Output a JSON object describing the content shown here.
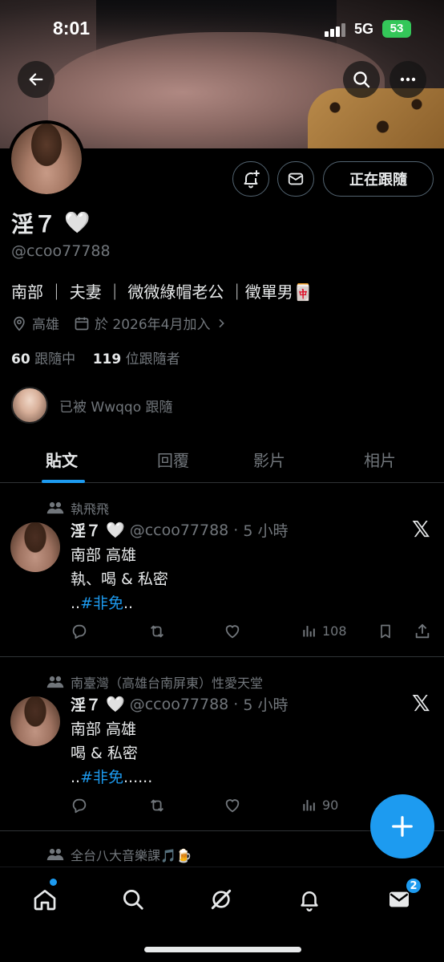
{
  "status_bar": {
    "time": "8:01",
    "network": "5G",
    "battery": "53"
  },
  "profile": {
    "name": "淫７",
    "name_emoji": "🤍",
    "handle": "@ccoo77788",
    "bio": "南部 ｜ 夫妻 ｜ 微微綠帽老公 ｜徵單男🀄",
    "location": "高雄",
    "joined": "於 2026年4月加入",
    "following_count": "60",
    "following_label": "跟隨中",
    "followers_count": "119",
    "followers_label": "位跟隨者",
    "followed_by": "已被 Wwqqo 跟隨",
    "follow_button": "正在跟隨"
  },
  "tabs": [
    "貼文",
    "回覆",
    "影片",
    "相片"
  ],
  "posts": [
    {
      "community": "執飛飛",
      "name": "淫７",
      "handle": "@ccoo77788",
      "time": "5 小時",
      "line1": "南部 高雄",
      "line2": "執、喝 & 私密",
      "prefix": "..",
      "hashtag": "#非免",
      "suffix": "..",
      "views": "108"
    },
    {
      "community": "南臺灣（高雄台南屏東）性愛天堂",
      "name": "淫７",
      "handle": "@ccoo77788",
      "time": "5 小時",
      "line1": "南部 高雄",
      "line2": "喝 & 私密",
      "prefix": "..",
      "hashtag": "#非免",
      "suffix": "......",
      "views": "90"
    },
    {
      "community": "全台八大音樂課🎵🍺"
    }
  ],
  "nav": {
    "messages_badge": "2"
  },
  "colors": {
    "accent": "#1d9bf0",
    "background": "#000000",
    "muted": "#71767b"
  }
}
